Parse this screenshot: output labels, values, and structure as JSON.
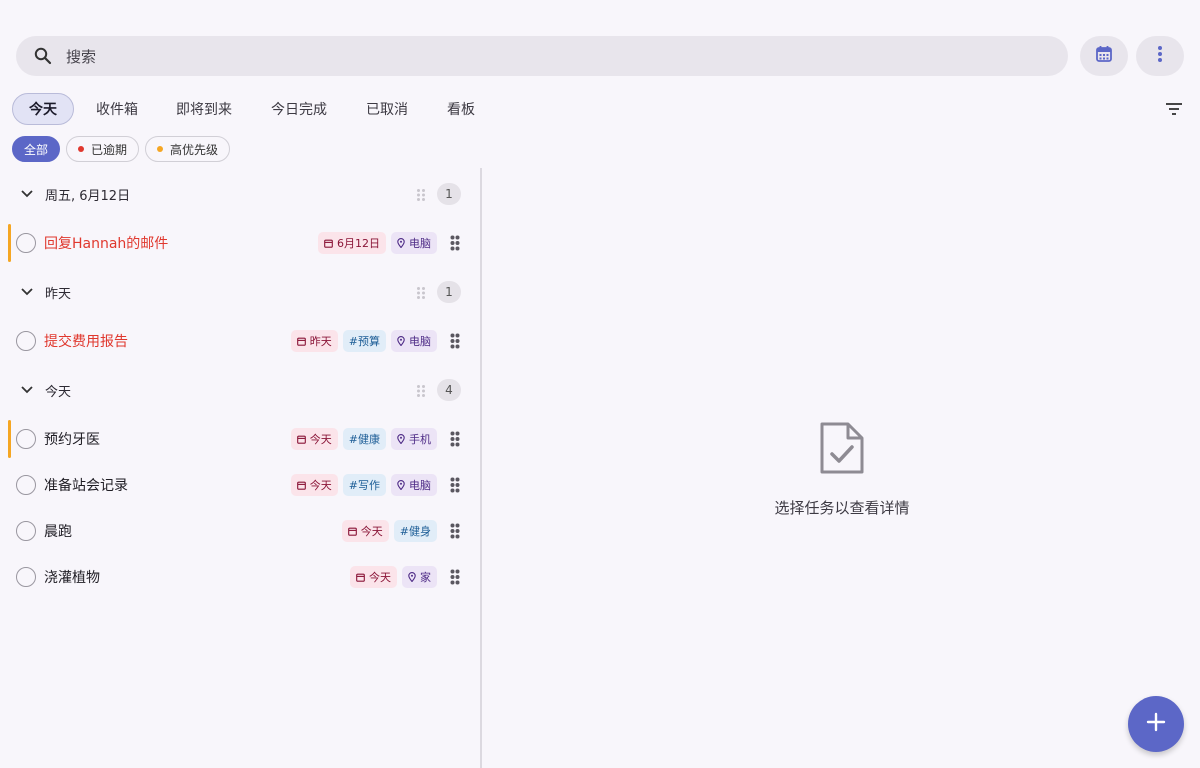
{
  "search": {
    "placeholder": "搜索"
  },
  "tabs": [
    {
      "label": "今天",
      "active": true
    },
    {
      "label": "收件箱"
    },
    {
      "label": "即将到来"
    },
    {
      "label": "今日完成"
    },
    {
      "label": "已取消"
    },
    {
      "label": "看板"
    }
  ],
  "chips": [
    {
      "label": "全部",
      "active": true
    },
    {
      "label": "已逾期",
      "dot": "#e0382e"
    },
    {
      "label": "高优先级",
      "dot": "#f5a623"
    }
  ],
  "groups": [
    {
      "title": "周五, 6月12日",
      "count": "1",
      "tasks": [
        {
          "title": "回复Hannah的邮件",
          "overdue": true,
          "priority": true,
          "tags": [
            {
              "type": "date",
              "label": "6月12日"
            },
            {
              "type": "loc",
              "label": "电脑"
            }
          ]
        }
      ]
    },
    {
      "title": "昨天",
      "count": "1",
      "tasks": [
        {
          "title": "提交费用报告",
          "overdue": true,
          "priority": false,
          "tags": [
            {
              "type": "date",
              "label": "昨天"
            },
            {
              "type": "hash",
              "label": "#预算"
            },
            {
              "type": "loc",
              "label": "电脑"
            }
          ]
        }
      ]
    },
    {
      "title": "今天",
      "count": "4",
      "tasks": [
        {
          "title": "预约牙医",
          "overdue": false,
          "priority": true,
          "tags": [
            {
              "type": "date",
              "label": "今天"
            },
            {
              "type": "hash",
              "label": "#健康"
            },
            {
              "type": "loc",
              "label": "手机"
            }
          ]
        },
        {
          "title": "准备站会记录",
          "overdue": false,
          "priority": false,
          "tags": [
            {
              "type": "date",
              "label": "今天"
            },
            {
              "type": "hash",
              "label": "#写作"
            },
            {
              "type": "loc",
              "label": "电脑"
            }
          ]
        },
        {
          "title": "晨跑",
          "overdue": false,
          "priority": false,
          "tags": [
            {
              "type": "date",
              "label": "今天"
            },
            {
              "type": "hash",
              "label": "#健身"
            }
          ]
        },
        {
          "title": "浇灌植物",
          "overdue": false,
          "priority": false,
          "tags": [
            {
              "type": "date",
              "label": "今天"
            },
            {
              "type": "loc",
              "label": "家"
            }
          ]
        }
      ]
    }
  ],
  "detail": {
    "empty_text": "选择任务以查看详情"
  },
  "colors": {
    "accent": "#5c67c7",
    "overdue": "#e0382e",
    "priority": "#f5a623"
  }
}
